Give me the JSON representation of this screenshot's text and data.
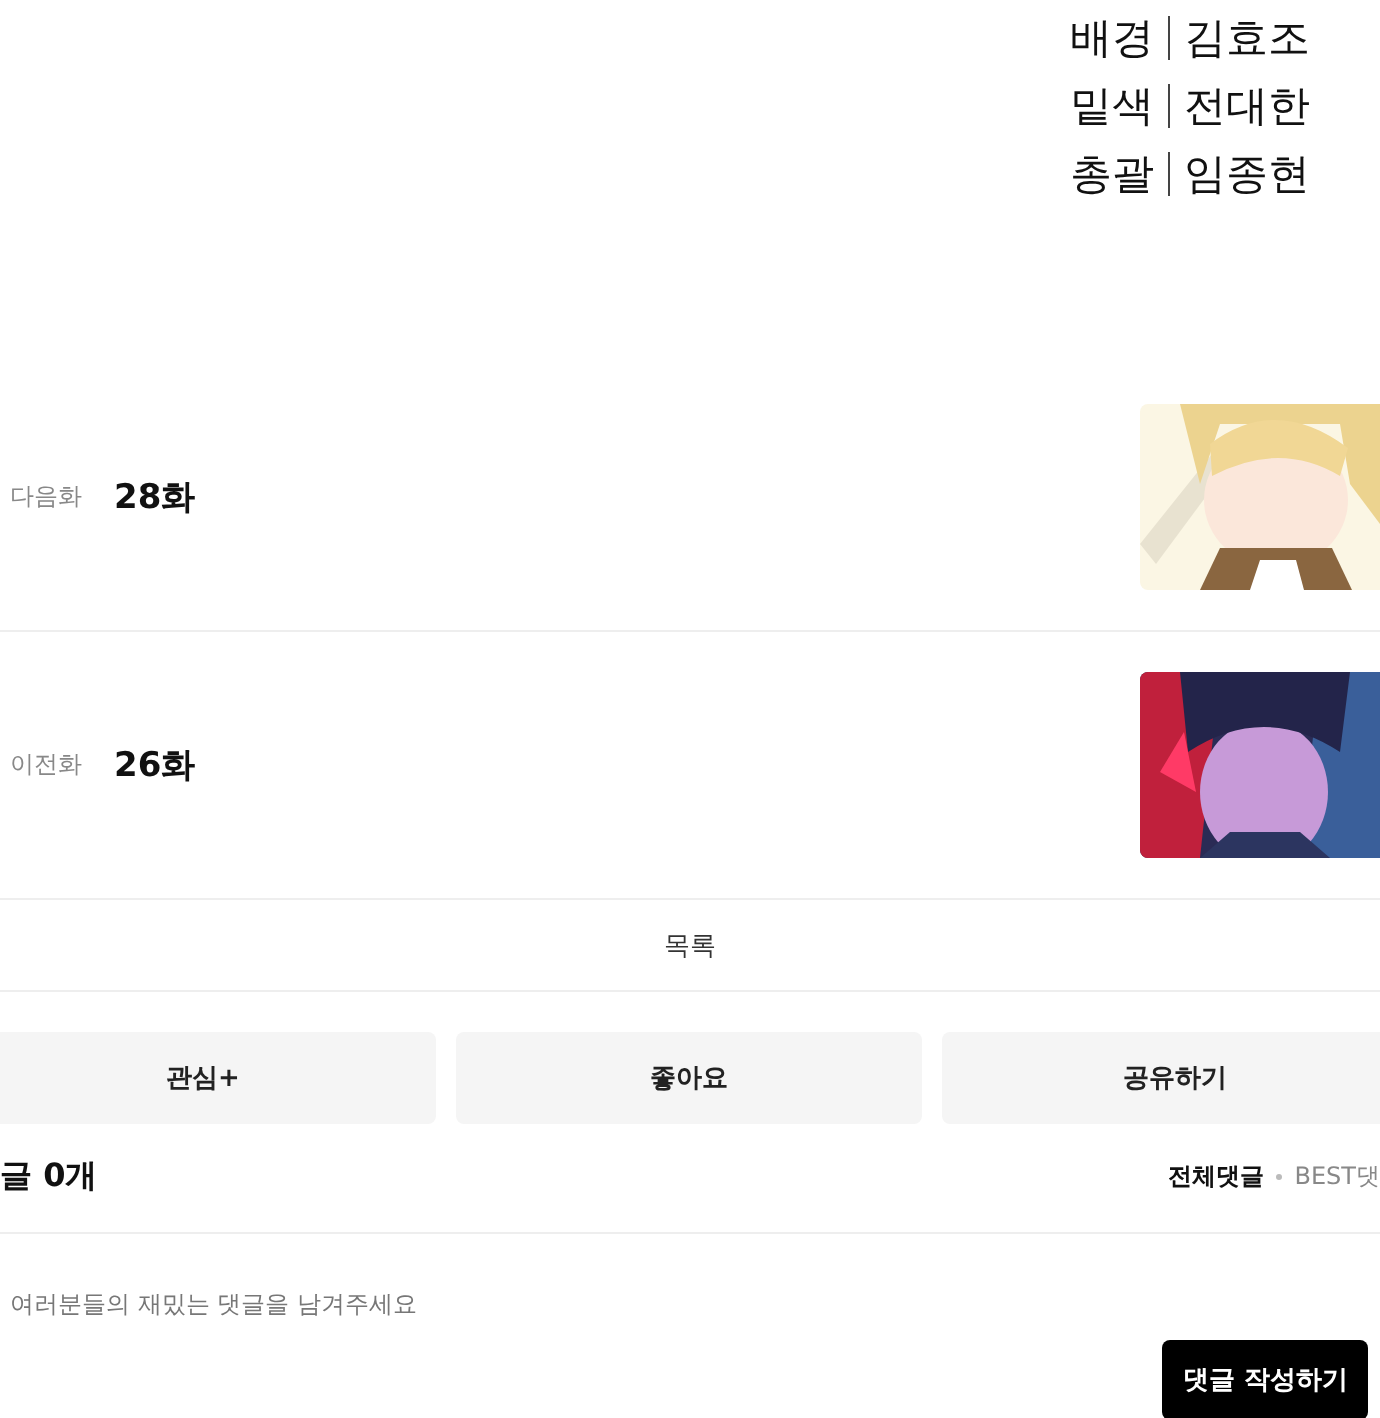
{
  "credits": [
    {
      "role": "배경",
      "name": "김효조"
    },
    {
      "role": "밑색",
      "name": "전대한"
    },
    {
      "role": "총괄",
      "name": "임종현"
    }
  ],
  "episodes": [
    {
      "label": "다음화",
      "title": "28화"
    },
    {
      "label": "이전화",
      "title": "26화"
    }
  ],
  "list_link": "목록",
  "actions": [
    "관심+",
    "좋아요",
    "공유하기"
  ],
  "comments": {
    "count_label": "글 0개",
    "sort_tabs": [
      {
        "label": "전체댓글",
        "selected": true
      },
      {
        "label": "BEST댓",
        "selected": false
      }
    ],
    "placeholder": "여러분들의 재밌는 댓글을 남겨주세요",
    "submit": "댓글 작성하기"
  }
}
